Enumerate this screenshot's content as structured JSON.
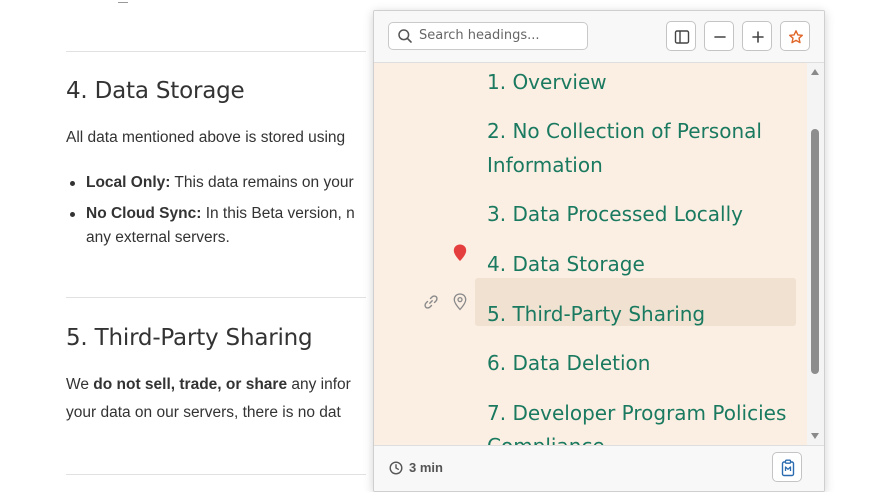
{
  "document": {
    "sections": [
      {
        "heading": "4. Data Storage",
        "intro": "All data mentioned above is stored using",
        "bullets": [
          {
            "label": "Local Only:",
            "text": " This data remains on your"
          },
          {
            "label": "No Cloud Sync:",
            "text": " In this Beta version, n",
            "continuation": "any external servers."
          }
        ]
      },
      {
        "heading": "5. Third-Party Sharing",
        "line1_pre": "We ",
        "line1_bold": "do not sell, trade, or share",
        "line1_post": " any infor",
        "line2": "your data on our servers, there is no dat"
      }
    ]
  },
  "panel": {
    "search": {
      "placeholder": "Search headings..."
    },
    "toolbar": {
      "sidebar_icon": "sidebar-toggle-icon",
      "zoom_out_icon": "minus-icon",
      "zoom_in_icon": "plus-icon",
      "favorite_icon": "star-icon"
    },
    "headings": [
      {
        "label": "1. Overview"
      },
      {
        "label": "2. No Collection of Personal",
        "label_cont": "Information"
      },
      {
        "label": "3. Data Processed Locally"
      },
      {
        "label": "4. Data Storage",
        "marker": "pin-red-icon"
      },
      {
        "label": "5. Third-Party Sharing",
        "hovered": true,
        "actions": [
          "link-icon",
          "pin-outline-icon"
        ]
      },
      {
        "label": "6. Data Deletion"
      },
      {
        "label": "7. Developer Program Policies",
        "label_cont": "Compliance"
      }
    ],
    "footer": {
      "read_time": "3 min",
      "clock_icon": "clock-icon",
      "copy_icon": "clipboard-icon"
    },
    "colors": {
      "heading_text": "#1a7a60",
      "list_background": "#fbeee3",
      "hover_background": "#f0e1d1",
      "pin_red": "#e53e3e",
      "star_orange": "#e0672a"
    }
  }
}
